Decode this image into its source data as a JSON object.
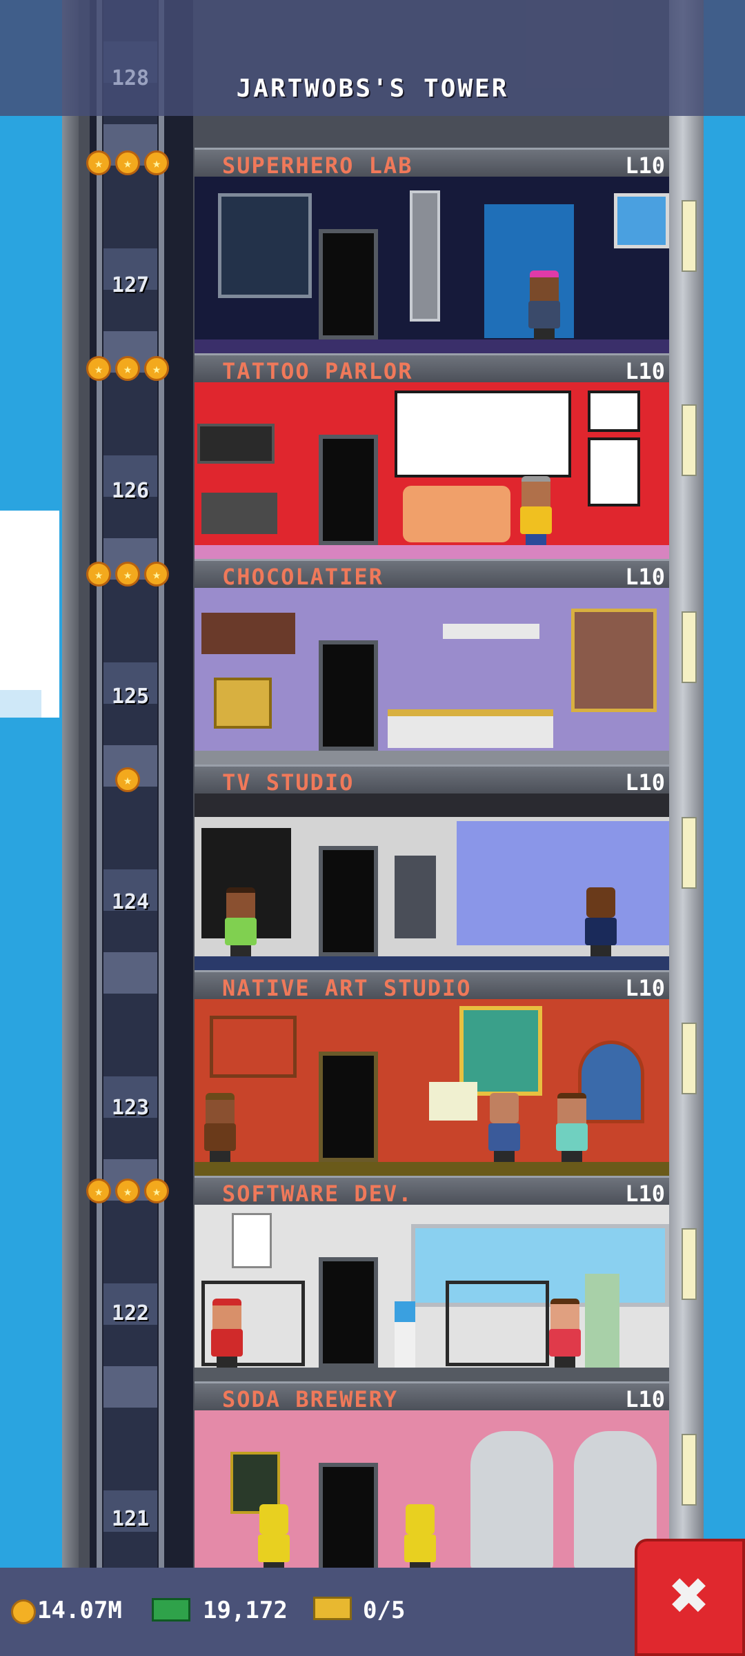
{
  "header": {
    "title": "JARTWOBS'S TOWER",
    "top_floor_number": "128"
  },
  "floors": [
    {
      "number": "127",
      "name": "SUPERHERO LAB",
      "level": "L10",
      "stars": "★★★",
      "wall_color": "#161a3a",
      "floor_color": "#3a2f6a"
    },
    {
      "number": "126",
      "name": "TATTOO PARLOR",
      "level": "L10",
      "stars": "★★★",
      "wall_color": "#e0262e",
      "floor_color": "#d884c0"
    },
    {
      "number": "125",
      "name": "CHOCOLATIER",
      "level": "L10",
      "stars": "★★★",
      "wall_color": "#9a8ccc",
      "floor_color": "#8a8e96"
    },
    {
      "number": "124",
      "name": "TV STUDIO",
      "level": "L10",
      "stars": "★",
      "wall_color": "#d4d4d4",
      "floor_color": "#2a3a6a"
    },
    {
      "number": "123",
      "name": "NATIVE ART STUDIO",
      "level": "L10",
      "stars": "",
      "wall_color": "#c8442a",
      "floor_color": "#6a5a1a"
    },
    {
      "number": "122",
      "name": "SOFTWARE DEV.",
      "level": "L10",
      "stars": "★★★",
      "wall_color": "#e2e2e2",
      "floor_color": "#555a62"
    },
    {
      "number": "121",
      "name": "SODA BREWERY",
      "level": "L10",
      "stars": "",
      "wall_color": "#e48aa8",
      "floor_color": "#8a8e96"
    }
  ],
  "status": {
    "coins": "14.07M",
    "bux": "19,172",
    "tickets": "0/5"
  },
  "icons": {
    "coin": "coin-icon",
    "bux": "bux-icon",
    "ticket": "ticket-icon",
    "close": "close-icon",
    "star": "star-icon"
  },
  "close_button": {
    "label": "✖"
  }
}
